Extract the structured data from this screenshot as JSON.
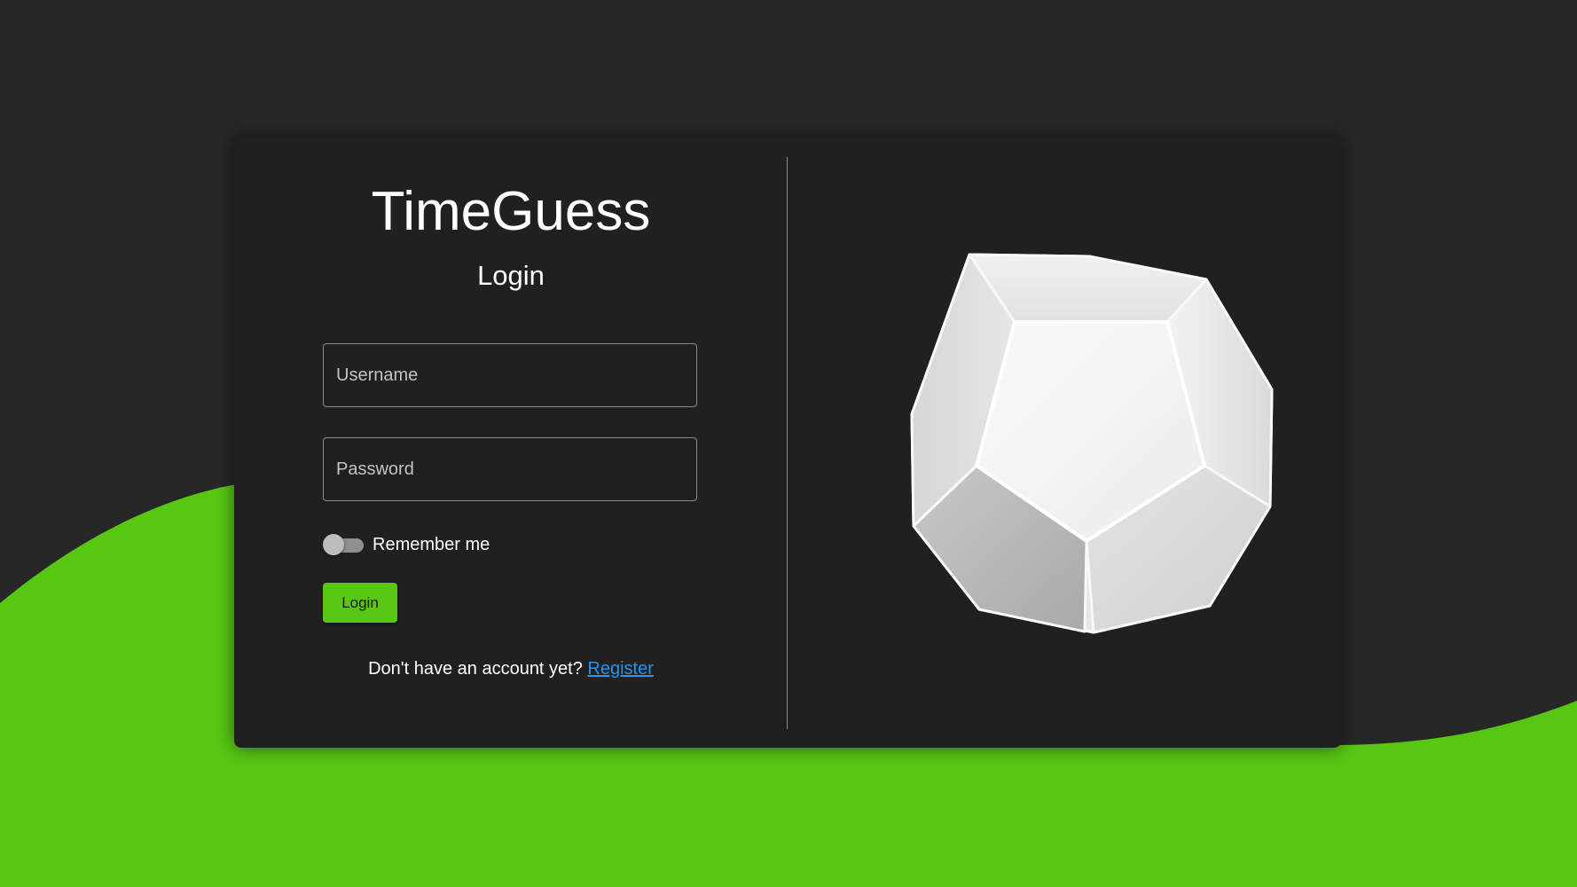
{
  "app": {
    "title": "TimeGuess",
    "page_title": "Login"
  },
  "form": {
    "username_placeholder": "Username",
    "username_value": "",
    "password_placeholder": "Password",
    "password_value": "",
    "remember_label": "Remember me",
    "remember_checked": false,
    "login_button": "Login"
  },
  "footer": {
    "prompt": "Don't have an account yet?",
    "register_link": "Register"
  },
  "colors": {
    "accent": "#58c714",
    "background": "#272727",
    "card": "#202020",
    "link": "#2196f3"
  },
  "illustration": {
    "icon": "dodecahedron-icon"
  }
}
